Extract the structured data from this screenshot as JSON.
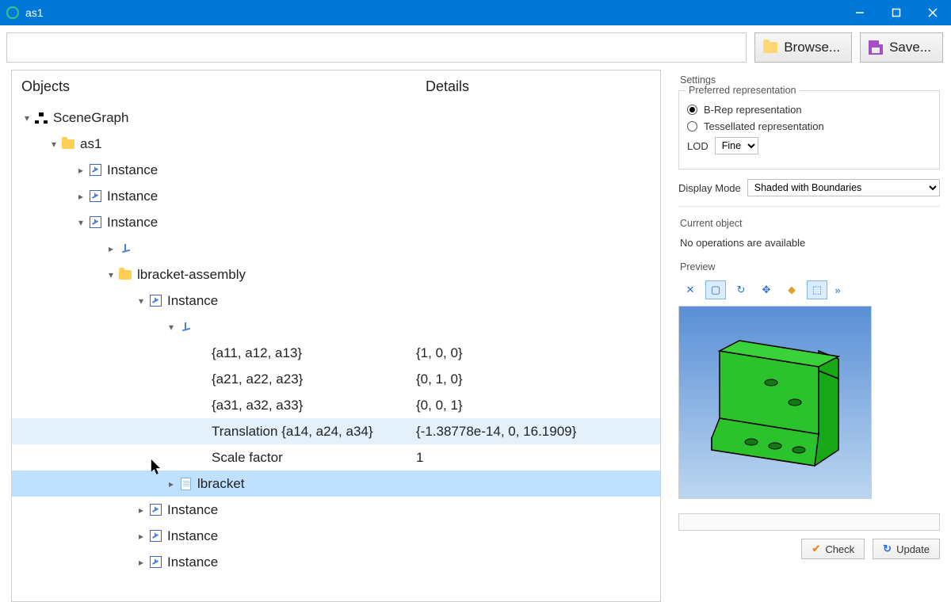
{
  "window": {
    "title": "as1"
  },
  "toolbar": {
    "browse": "Browse...",
    "save": "Save..."
  },
  "panel": {
    "objects_header": "Objects",
    "details_header": "Details"
  },
  "tree": {
    "root": "SceneGraph",
    "as1": "as1",
    "instance": "Instance",
    "lbracket_assembly": "lbracket-assembly",
    "matrix": {
      "r1_label": "{a11, a12, a13}",
      "r1_val": "{1, 0, 0}",
      "r2_label": "{a21, a22, a23}",
      "r2_val": "{0, 1, 0}",
      "r3_label": "{a31, a32, a33}",
      "r3_val": "{0, 0, 1}",
      "trans_label": "Translation {a14, a24, a34}",
      "trans_val": "{-1.38778e-14, 0, 16.1909}",
      "scale_label": "Scale factor",
      "scale_val": "1"
    },
    "lbracket": "lbracket"
  },
  "settings": {
    "title": "Settings",
    "pref_title": "Preferred representation",
    "brep": "B-Rep representation",
    "tess": "Tessellated representation",
    "lod_label": "LOD",
    "lod_value": "Fine",
    "display_mode_label": "Display Mode",
    "display_mode_value": "Shaded with Boundaries"
  },
  "current": {
    "title": "Current object",
    "text": "No operations are available"
  },
  "preview": {
    "title": "Preview"
  },
  "actions": {
    "check": "Check",
    "update": "Update"
  }
}
